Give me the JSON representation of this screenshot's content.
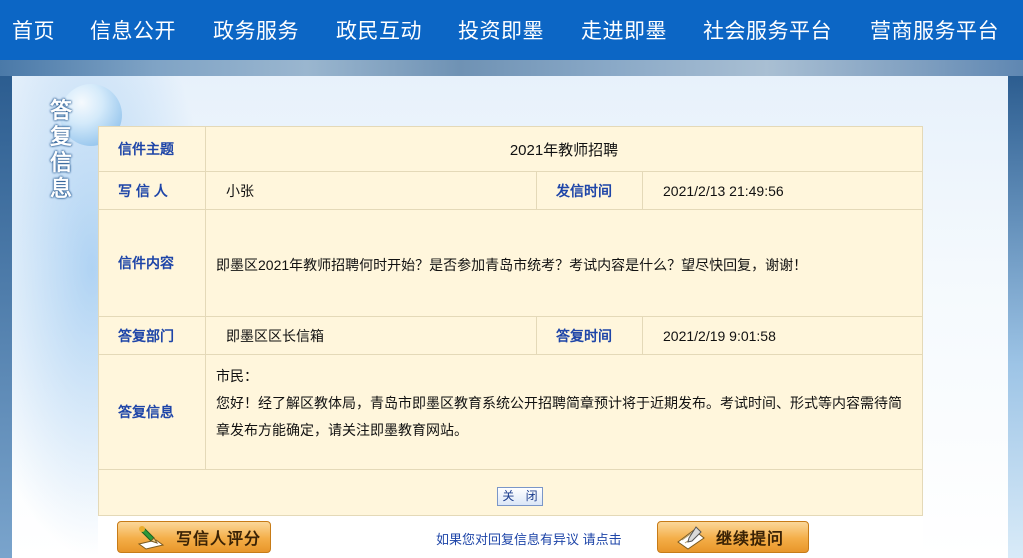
{
  "nav": {
    "items": [
      "首页",
      "信息公开",
      "政务服务",
      "政民互动",
      "投资即墨",
      "走进即墨",
      "社会服务平台",
      "营商服务平台"
    ]
  },
  "side_title": [
    "答",
    "复",
    "信",
    "息"
  ],
  "letter": {
    "subject_label": "信件主题",
    "subject": "2021年教师招聘",
    "writer_label": "写 信 人",
    "writer": "小张",
    "sent_time_label": "发信时间",
    "sent_time": "2021/2/13 21:49:56",
    "content_label": "信件内容",
    "content": "即墨区2021年教师招聘何时开始？是否参加青岛市统考？考试内容是什么？望尽快回复，谢谢！",
    "reply_dept_label": "答复部门",
    "reply_dept": "即墨区区长信箱",
    "reply_time_label": "答复时间",
    "reply_time": "2021/2/19 9:01:58",
    "reply_label": "答复信息",
    "reply_greeting": "市民：",
    "reply_line1": "您好！经了解区教体局，青岛市即墨区教育系统公开招聘简章预计将于近期发布。考试时间、形式等内容需待简",
    "reply_line2": "章发布方能确定，请关注即墨教育网站。"
  },
  "buttons": {
    "close": "关 闭",
    "rate": "写信人评分",
    "continue": "继续提问",
    "appeal_link": "如果您对回复信息有异议 请点击"
  },
  "colors": {
    "nav_bg": "#0c66c5",
    "label_blue": "#1e45a8",
    "table_bg": "#fff6dc",
    "orange_button": "#f4ae48"
  }
}
